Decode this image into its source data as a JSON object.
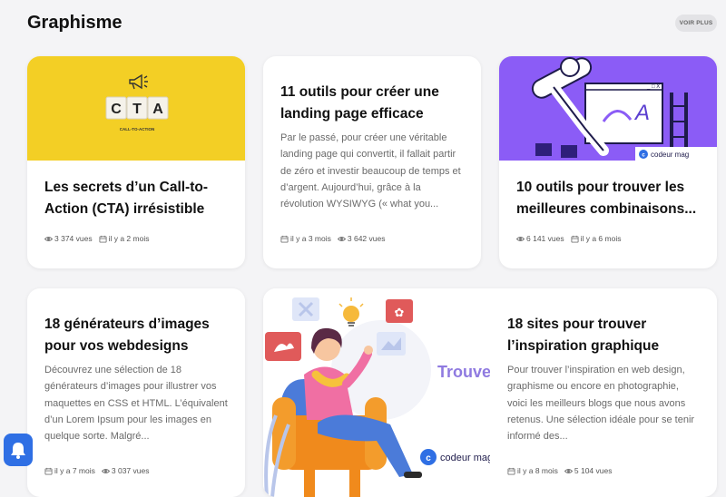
{
  "section": {
    "title": "Graphisme",
    "see_more": "VOIR PLUS"
  },
  "cards": [
    {
      "title": "Les secrets d’un Call-to-Action (CTA) irrésistible",
      "image": {
        "tiles": [
          "C",
          "T",
          "A"
        ],
        "caption": "CALL-TO-ACTION"
      },
      "views": "3 374 vues",
      "date": "il y a 2 mois"
    },
    {
      "title": "11 outils pour créer une landing page efficace",
      "excerpt": "Par le passé, pour créer une véritable landing page qui convertit, il fallait partir de zéro et investir beaucoup de temps et d’argent. Aujourd’hui, grâce à la révolution WYSIWYG (« what you...",
      "date": "il y a 3 mois",
      "views": "3 642 vues"
    },
    {
      "title": "10 outils pour trouver les meilleures combinaisons...",
      "image": {
        "letter": "A",
        "brand": "codeur mag"
      },
      "views": "6 141 vues",
      "date": "il y a 6 mois"
    },
    {
      "title": "18 générateurs d’images pour vos webdesigns",
      "excerpt": "Découvrez une sélection de 18 générateurs d’images pour illustrer vos maquettes en CSS et HTML. L’équivalent d’un Lorem Ipsum pour les images en quelque sorte. Malgré...",
      "date": "il y a 7 mois",
      "views": "3 037 vues"
    },
    {
      "title": "18 sites pour trouver l’inspiration graphique",
      "image": {
        "heading": "Trouver l’inspiration",
        "brand": "codeur mag"
      },
      "excerpt": "Pour trouver l’inspiration en web design, graphisme ou encore en photographie, voici les meilleurs blogs que nous avons retenus. Une sélection idéale pour se tenir informé des...",
      "date": "il y a 8 mois",
      "views": "5 104 vues"
    }
  ],
  "icons": {
    "views": "eye-icon",
    "date": "calendar-icon",
    "notification": "bell-icon"
  },
  "colors": {
    "brand_blue": "#2f6fe4",
    "cta_yellow": "#f3cf25",
    "purple": "#8b5cf6",
    "orange": "#f08a1c"
  }
}
